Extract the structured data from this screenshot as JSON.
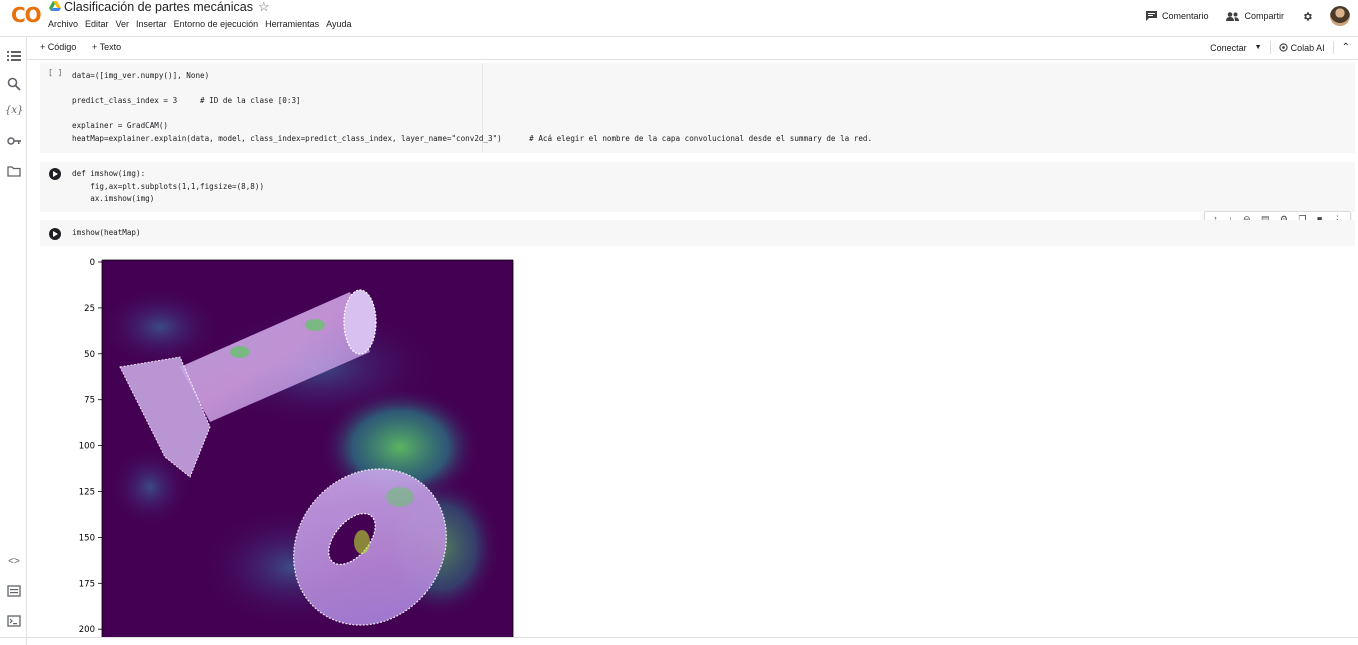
{
  "app": {
    "logo_text": "CO",
    "notebook_title": "Clasificación de partes mecánicas",
    "menu": [
      "Archivo",
      "Editar",
      "Ver",
      "Insertar",
      "Entorno de ejecución",
      "Herramientas",
      "Ayuda"
    ],
    "comment_label": "Comentario",
    "share_label": "Compartir"
  },
  "toolbar": {
    "add_code": "+ Código",
    "add_text": "+ Texto",
    "connect_label": "Conectar",
    "colab_ai_label": "Colab AI"
  },
  "cells": {
    "cell1": {
      "brackets": "[ ]",
      "lines": [
        "data=([img_ver.numpy()], None)",
        "",
        "predict_class_index = 3     # ID de la clase [0:3]",
        "",
        "explainer = GradCAM()",
        "heatMap=explainer.explain(data, model, class_index=predict_class_index, layer_name=\"conv2d_3\")      # Acá elegir el nombre de la capa convolucional desde el summary de la red."
      ]
    },
    "cell2": {
      "lines": [
        "def imshow(img):",
        "    fig,ax=plt.subplots(1,1,figsize=(8,8))",
        "    ax.imshow(img)"
      ]
    },
    "cell3": {
      "lines": [
        "imshow(heatMap)"
      ]
    }
  },
  "chart_data": {
    "type": "heatmap",
    "title": "",
    "xlabel": "",
    "ylabel": "",
    "y_ticks": [
      0,
      25,
      50,
      75,
      100,
      125,
      150,
      175,
      200
    ],
    "ylim": [
      0,
      205
    ],
    "colormap": "viridis",
    "background_color": "#440154",
    "highlight_colors": [
      "#21918c",
      "#5ec962",
      "#3b528b"
    ]
  },
  "colors": {
    "cell_bg": "#f7f7f7",
    "keyword": "#0000ff",
    "comment": "#008000",
    "string": "#a31515",
    "logo_yellow": "#f9ab00",
    "logo_orange": "#e8710a"
  }
}
